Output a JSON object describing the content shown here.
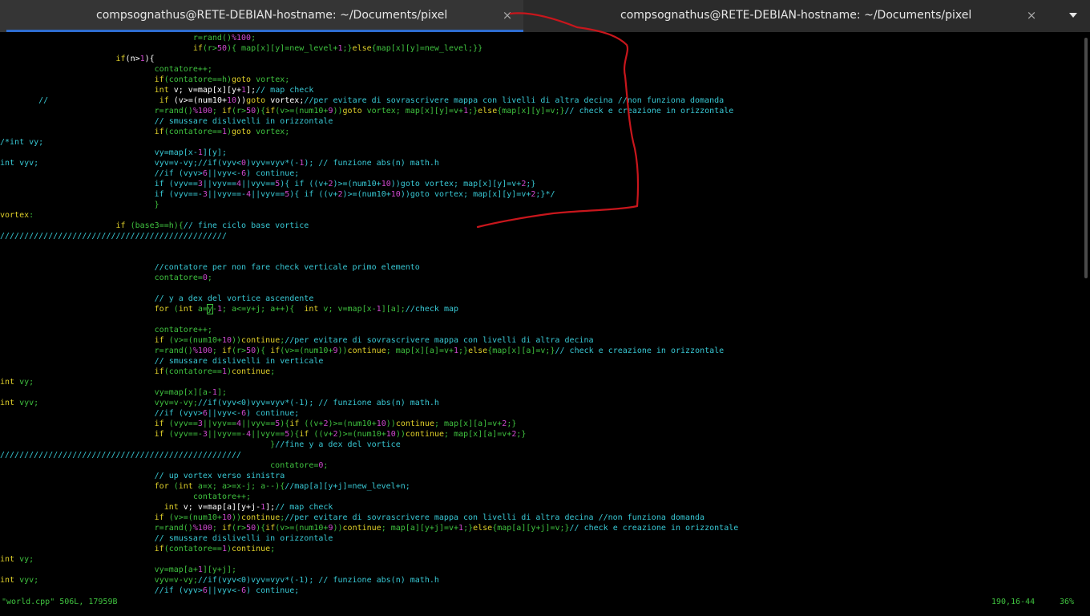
{
  "tabs": [
    {
      "title": "compsognathus@RETE-DEBIAN-hostname: ~/Documents/pixel",
      "active": true
    },
    {
      "title": "compsognathus@RETE-DEBIAN-hostname: ~/Documents/pixel",
      "active": false
    }
  ],
  "icons": {
    "close": "×",
    "menu": "chevron-down"
  },
  "colors": {
    "keyword": "#e0d02a",
    "text": "#3fc13f",
    "comment": "#38c8d4",
    "number": "#d04ad0",
    "annotation": "#c8161c",
    "active_tab_underline": "#2e6dd0"
  },
  "code_lines": [
    [
      [
        "",
        "                                        "
      ],
      [
        "g",
        "r=rand()"
      ],
      [
        "m",
        "%100"
      ],
      [
        "g",
        ";"
      ]
    ],
    [
      [
        "",
        "                                        "
      ],
      [
        "y",
        "if"
      ],
      [
        "g",
        "(r>"
      ],
      [
        "m",
        "50"
      ],
      [
        "g",
        "){ map[x][y]=new_level+"
      ],
      [
        "m",
        "1"
      ],
      [
        "g",
        ";}"
      ],
      [
        "y",
        "else"
      ],
      [
        "g",
        "{map[x][y]=new_level;}}"
      ]
    ],
    [
      [
        "",
        "                        "
      ],
      [
        "y",
        "if"
      ],
      [
        "w",
        "(n>"
      ],
      [
        "m",
        "1"
      ],
      [
        "w",
        "){"
      ]
    ],
    [
      [
        "",
        "                                "
      ],
      [
        "g",
        "contatore++;"
      ]
    ],
    [
      [
        "",
        "                                "
      ],
      [
        "y",
        "if"
      ],
      [
        "g",
        "(contatore==h)"
      ],
      [
        "y",
        "goto"
      ],
      [
        "g",
        " vortex;"
      ]
    ],
    [
      [
        "",
        "                                "
      ],
      [
        "y",
        "int"
      ],
      [
        "w",
        " v; v=map[x][y+"
      ],
      [
        "m",
        "1"
      ],
      [
        "w",
        "];"
      ],
      [
        "c",
        "// map check"
      ]
    ],
    [
      [
        "c",
        "        //"
      ],
      [
        "",
        "                       "
      ],
      [
        "y",
        "if"
      ],
      [
        "w",
        " (v>=(num10+"
      ],
      [
        "m",
        "10"
      ],
      [
        "w",
        "))"
      ],
      [
        "y",
        "goto"
      ],
      [
        "w",
        " vortex;"
      ],
      [
        "c",
        "//per evitare di sovrascrivere mappa con livelli di altra decina //non funziona domanda"
      ]
    ],
    [
      [
        "",
        "                                "
      ],
      [
        "g",
        "r=rand()"
      ],
      [
        "m",
        "%100"
      ],
      [
        "g",
        "; "
      ],
      [
        "y",
        "if"
      ],
      [
        "g",
        "(r>"
      ],
      [
        "m",
        "50"
      ],
      [
        "g",
        "){"
      ],
      [
        "y",
        "if"
      ],
      [
        "g",
        "(v>=(num10+"
      ],
      [
        "m",
        "9"
      ],
      [
        "g",
        "))"
      ],
      [
        "y",
        "goto"
      ],
      [
        "g",
        " vortex; map[x][y]=v+"
      ],
      [
        "m",
        "1"
      ],
      [
        "g",
        ";}"
      ],
      [
        "y",
        "else"
      ],
      [
        "g",
        "{map[x][y]=v;}"
      ],
      [
        "c",
        "// check e creazione in orizzontale"
      ]
    ],
    [
      [
        "",
        "                                "
      ],
      [
        "c",
        "// smussare dislivelli in orizzontale"
      ]
    ],
    [
      [
        "",
        "                                "
      ],
      [
        "y",
        "if"
      ],
      [
        "g",
        "(contatore=="
      ],
      [
        "m",
        "1"
      ],
      [
        "g",
        ")"
      ],
      [
        "y",
        "goto"
      ],
      [
        "g",
        " vortex;"
      ]
    ],
    [
      [
        "c",
        "/*int vy;"
      ]
    ],
    [
      [
        "",
        "                                "
      ],
      [
        "c",
        "vy=map[x-"
      ],
      [
        "m",
        "1"
      ],
      [
        "c",
        "][y];"
      ]
    ],
    [
      [
        "c",
        "int vyv;"
      ],
      [
        "",
        "                        "
      ],
      [
        "c",
        "vyv=v-vy;//if(vyv<"
      ],
      [
        "m",
        "0"
      ],
      [
        "c",
        ")vyv=vyv*(-"
      ],
      [
        "m",
        "1"
      ],
      [
        "c",
        "); // funzione abs(n) math.h"
      ]
    ],
    [
      [
        "",
        "                                "
      ],
      [
        "c",
        "//if (vyv>"
      ],
      [
        "m",
        "6"
      ],
      [
        "c",
        "||vyv<-"
      ],
      [
        "m",
        "6"
      ],
      [
        "c",
        ") continue;"
      ]
    ],
    [
      [
        "",
        "                                "
      ],
      [
        "c",
        "if (vyv=="
      ],
      [
        "m",
        "3"
      ],
      [
        "c",
        "||vyv=="
      ],
      [
        "m",
        "4"
      ],
      [
        "c",
        "||vyv=="
      ],
      [
        "m",
        "5"
      ],
      [
        "c",
        "){ if ((v+"
      ],
      [
        "m",
        "2"
      ],
      [
        "c",
        ")>=(num10+"
      ],
      [
        "m",
        "10"
      ],
      [
        "c",
        "))goto vortex; map[x][y]=v+"
      ],
      [
        "m",
        "2"
      ],
      [
        "c",
        ";}"
      ]
    ],
    [
      [
        "",
        "                                "
      ],
      [
        "c",
        "if (vyv==-"
      ],
      [
        "m",
        "3"
      ],
      [
        "c",
        "||vyv==-"
      ],
      [
        "m",
        "4"
      ],
      [
        "c",
        "||vyv=="
      ],
      [
        "m",
        "5"
      ],
      [
        "c",
        "){ if ((v+"
      ],
      [
        "m",
        "2"
      ],
      [
        "c",
        ")>=(num10+"
      ],
      [
        "m",
        "10"
      ],
      [
        "c",
        "))goto vortex; map[x][y]=v+"
      ],
      [
        "m",
        "2"
      ],
      [
        "c",
        ";}*/"
      ]
    ],
    [
      [
        "",
        "                                "
      ],
      [
        "g",
        "}"
      ]
    ],
    [
      [
        "y",
        "vortex"
      ],
      [
        "g",
        ":"
      ]
    ],
    [
      [
        "",
        "                        "
      ],
      [
        "y",
        "if"
      ],
      [
        "g",
        " (base3==h){"
      ],
      [
        "c",
        "// fine ciclo base vortice"
      ]
    ],
    [
      [
        "c",
        "///////////////////////////////////////////////"
      ]
    ],
    [
      [
        "",
        ""
      ]
    ],
    [
      [
        "",
        ""
      ]
    ],
    [
      [
        "",
        "                                "
      ],
      [
        "c",
        "//contatore per non fare check verticale primo elemento"
      ]
    ],
    [
      [
        "",
        "                                "
      ],
      [
        "g",
        "contatore="
      ],
      [
        "m",
        "0"
      ],
      [
        "g",
        ";"
      ]
    ],
    [
      [
        "",
        ""
      ]
    ],
    [
      [
        "",
        "                                "
      ],
      [
        "c",
        "// y a dex del vortice ascendente"
      ]
    ],
    [
      [
        "",
        "                                "
      ],
      [
        "y",
        "for"
      ],
      [
        "g",
        " ("
      ],
      [
        "y",
        "int"
      ],
      [
        "g",
        " a="
      ],
      [
        "cur",
        "y"
      ],
      [
        "g",
        "-"
      ],
      [
        "m",
        "1"
      ],
      [
        "g",
        "; a<=y+j; a++){  "
      ],
      [
        "y",
        "int"
      ],
      [
        "g",
        " v; v=map[x-"
      ],
      [
        "m",
        "1"
      ],
      [
        "g",
        "][a];"
      ],
      [
        "c",
        "//check map"
      ]
    ],
    [
      [
        "",
        ""
      ]
    ],
    [
      [
        "",
        "                                "
      ],
      [
        "g",
        "contatore++;"
      ]
    ],
    [
      [
        "",
        "                                "
      ],
      [
        "y",
        "if"
      ],
      [
        "g",
        " (v>=(num10+"
      ],
      [
        "m",
        "10"
      ],
      [
        "g",
        "))"
      ],
      [
        "y",
        "continue"
      ],
      [
        "g",
        ";"
      ],
      [
        "c",
        "//per evitare di sovrascrivere mappa con livelli di altra decina"
      ]
    ],
    [
      [
        "",
        "                                "
      ],
      [
        "g",
        "r=rand()"
      ],
      [
        "m",
        "%100"
      ],
      [
        "g",
        "; "
      ],
      [
        "y",
        "if"
      ],
      [
        "g",
        "(r>"
      ],
      [
        "m",
        "50"
      ],
      [
        "g",
        "){ "
      ],
      [
        "y",
        "if"
      ],
      [
        "g",
        "(v>=(num10+"
      ],
      [
        "m",
        "9"
      ],
      [
        "g",
        "))"
      ],
      [
        "y",
        "continue"
      ],
      [
        "g",
        "; map[x][a]=v+"
      ],
      [
        "m",
        "1"
      ],
      [
        "g",
        ";}"
      ],
      [
        "y",
        "else"
      ],
      [
        "g",
        "{map[x][a]=v;}"
      ],
      [
        "c",
        "// check e creazione in orizzontale"
      ]
    ],
    [
      [
        "",
        "                                "
      ],
      [
        "c",
        "// smussare dislivelli in verticale"
      ]
    ],
    [
      [
        "",
        "                                "
      ],
      [
        "y",
        "if"
      ],
      [
        "g",
        "(contatore=="
      ],
      [
        "m",
        "1"
      ],
      [
        "g",
        ")"
      ],
      [
        "y",
        "continue"
      ],
      [
        "g",
        ";"
      ]
    ],
    [
      [
        "y",
        "int"
      ],
      [
        "g",
        " vy;"
      ]
    ],
    [
      [
        "",
        "                                "
      ],
      [
        "g",
        "vy=map[x][a-"
      ],
      [
        "m",
        "1"
      ],
      [
        "g",
        "];"
      ]
    ],
    [
      [
        "y",
        "int"
      ],
      [
        "g",
        " vyv;"
      ],
      [
        "",
        "                        "
      ],
      [
        "g",
        "vyv=v-vy;"
      ],
      [
        "c",
        "//if(vyv<0)vyv=vyv*(-1); // funzione abs(n) math.h"
      ]
    ],
    [
      [
        "",
        "                                "
      ],
      [
        "c",
        "//if (vyv>"
      ],
      [
        "m",
        "6"
      ],
      [
        "c",
        "||vyv<-"
      ],
      [
        "m",
        "6"
      ],
      [
        "c",
        ") continue;"
      ]
    ],
    [
      [
        "",
        "                                "
      ],
      [
        "y",
        "if"
      ],
      [
        "g",
        " (vyv=="
      ],
      [
        "m",
        "3"
      ],
      [
        "g",
        "||vyv=="
      ],
      [
        "m",
        "4"
      ],
      [
        "g",
        "||vyv=="
      ],
      [
        "m",
        "5"
      ],
      [
        "g",
        ")"
      ],
      [
        "g",
        "{"
      ],
      [
        "y",
        "if"
      ],
      [
        "g",
        " ((v+"
      ],
      [
        "m",
        "2"
      ],
      [
        "g",
        ")>=(num10+"
      ],
      [
        "m",
        "10"
      ],
      [
        "g",
        "))"
      ],
      [
        "y",
        "continue"
      ],
      [
        "g",
        "; map[x][a]=v+"
      ],
      [
        "m",
        "2"
      ],
      [
        "g",
        ";}"
      ]
    ],
    [
      [
        "",
        "                                "
      ],
      [
        "y",
        "if"
      ],
      [
        "g",
        " (vyv==-"
      ],
      [
        "m",
        "3"
      ],
      [
        "g",
        "||vyv==-"
      ],
      [
        "m",
        "4"
      ],
      [
        "g",
        "||vyv=="
      ],
      [
        "m",
        "5"
      ],
      [
        "g",
        ")"
      ],
      [
        "g",
        "{"
      ],
      [
        "y",
        "if"
      ],
      [
        "g",
        " ((v+"
      ],
      [
        "m",
        "2"
      ],
      [
        "g",
        ")>=(num10+"
      ],
      [
        "m",
        "10"
      ],
      [
        "g",
        "))"
      ],
      [
        "y",
        "continue"
      ],
      [
        "g",
        "; map[x][a]=v+"
      ],
      [
        "m",
        "2"
      ],
      [
        "g",
        ";}"
      ]
    ],
    [
      [
        "",
        "                                                        "
      ],
      [
        "g",
        "}"
      ],
      [
        "c",
        "//fine y a dex del vortice"
      ]
    ],
    [
      [
        "c",
        "//////////////////////////////////////////////////"
      ]
    ],
    [
      [
        "",
        "                                                        "
      ],
      [
        "g",
        "contatore="
      ],
      [
        "m",
        "0"
      ],
      [
        "g",
        ";"
      ]
    ],
    [
      [
        "",
        "                                "
      ],
      [
        "c",
        "// up vortex verso sinistra"
      ]
    ],
    [
      [
        "",
        "                                "
      ],
      [
        "y",
        "for"
      ],
      [
        "g",
        " ("
      ],
      [
        "y",
        "int"
      ],
      [
        "g",
        " a=x; a>=x-j; a--){"
      ],
      [
        "c",
        "//map[a][y+j]=new_level+n;"
      ]
    ],
    [
      [
        "",
        "                                        "
      ],
      [
        "g",
        "contatore++;"
      ]
    ],
    [
      [
        "",
        "                                  "
      ],
      [
        "y",
        "int"
      ],
      [
        "w",
        " v; v=map[a][y+j-"
      ],
      [
        "m",
        "1"
      ],
      [
        "w",
        "];"
      ],
      [
        "c",
        "// map check"
      ]
    ],
    [
      [
        "",
        "                                "
      ],
      [
        "y",
        "if"
      ],
      [
        "g",
        " (v>=(num10+"
      ],
      [
        "m",
        "10"
      ],
      [
        "g",
        "))"
      ],
      [
        "y",
        "continue"
      ],
      [
        "g",
        ";"
      ],
      [
        "c",
        "//per evitare di sovrascrivere mappa con livelli di altra decina //non funziona domanda"
      ]
    ],
    [
      [
        "",
        "                                "
      ],
      [
        "g",
        "r=rand()"
      ],
      [
        "m",
        "%100"
      ],
      [
        "g",
        "; "
      ],
      [
        "y",
        "if"
      ],
      [
        "g",
        "(r>"
      ],
      [
        "m",
        "50"
      ],
      [
        "g",
        "){"
      ],
      [
        "y",
        "if"
      ],
      [
        "g",
        "(v>=(num10+"
      ],
      [
        "m",
        "9"
      ],
      [
        "g",
        "))"
      ],
      [
        "y",
        "continue"
      ],
      [
        "g",
        "; map[a][y+j]=v+"
      ],
      [
        "m",
        "1"
      ],
      [
        "g",
        ";}"
      ],
      [
        "y",
        "else"
      ],
      [
        "g",
        "{map[a][y+j]=v;}"
      ],
      [
        "c",
        "// check e creazione in orizzontale"
      ]
    ],
    [
      [
        "",
        "                                "
      ],
      [
        "c",
        "// smussare dislivelli in orizzontale"
      ]
    ],
    [
      [
        "",
        "                                "
      ],
      [
        "y",
        "if"
      ],
      [
        "g",
        "(contatore=="
      ],
      [
        "m",
        "1"
      ],
      [
        "g",
        ")"
      ],
      [
        "y",
        "continue"
      ],
      [
        "g",
        ";"
      ]
    ],
    [
      [
        "y",
        "int"
      ],
      [
        "g",
        " vy;"
      ]
    ],
    [
      [
        "",
        "                                "
      ],
      [
        "g",
        "vy=map[a+"
      ],
      [
        "m",
        "1"
      ],
      [
        "g",
        "][y+j];"
      ]
    ],
    [
      [
        "y",
        "int"
      ],
      [
        "g",
        " vyv;"
      ],
      [
        "",
        "                        "
      ],
      [
        "g",
        "vyv=v-vy;"
      ],
      [
        "c",
        "//if(vyv<0)vyv=vyv*(-1); // funzione abs(n) math.h"
      ]
    ],
    [
      [
        "",
        "                                "
      ],
      [
        "c",
        "//if (vyv>"
      ],
      [
        "m",
        "6"
      ],
      [
        "c",
        "||vyv<-"
      ],
      [
        "m",
        "6"
      ],
      [
        "c",
        ") continue;"
      ]
    ]
  ],
  "statusbar": {
    "file": "\"world.cpp\" 506L, 17959B",
    "position": "190,16-44",
    "percent": "36%"
  }
}
